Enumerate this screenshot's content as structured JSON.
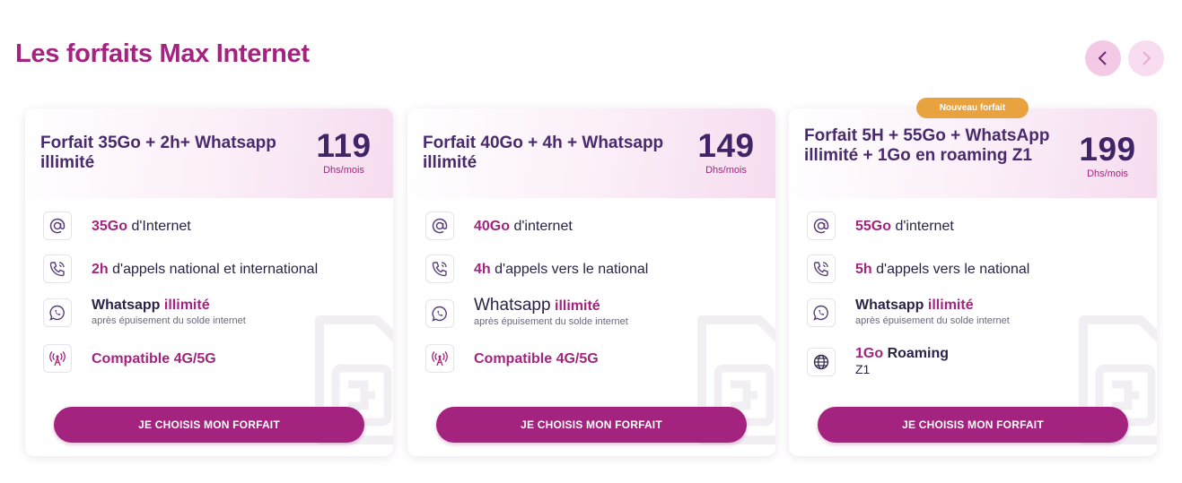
{
  "title": "Les forfaits Max Internet",
  "badge": "Nouveau forfait",
  "cards": [
    {
      "name": "Forfait 35Go + 2h+ Whatsapp illimité",
      "price": "119",
      "unit": "Dhs/mois",
      "f1_hl": "35Go",
      "f1_txt": "d'Internet",
      "f2_hl": "2h",
      "f2_txt": "d'appels national et international",
      "f3_txt": "Whatsapp",
      "f3_hl": "illimité",
      "f3_sub": "après épuisement du solde internet",
      "f4_hl": "Compatible 4G/5G",
      "cta": "JE CHOISIS MON FORFAIT"
    },
    {
      "name": "Forfait 40Go + 4h + Whatsapp illimité",
      "price": "149",
      "unit": "Dhs/mois",
      "f1_hl": "40Go",
      "f1_txt": "d'internet",
      "f2_hl": "4h",
      "f2_txt": "d'appels vers le national",
      "f3_txt": "Whatsapp",
      "f3_hl": "illimité",
      "f3_sub": "après épuisement du solde internet",
      "f4_hl": "Compatible 4G/5G",
      "cta": "JE CHOISIS MON FORFAIT"
    },
    {
      "name": "Forfait 5H + 55Go + WhatsApp illimité + 1Go en roaming Z1",
      "price": "199",
      "unit": "Dhs/mois",
      "f1_hl": "55Go",
      "f1_txt": "d'internet",
      "f2_hl": "5h",
      "f2_txt": "d'appels vers le national",
      "f3_txt": "Whatsapp",
      "f3_hl": "illimité",
      "f3_sub": "après épuisement du solde internet",
      "f4_hl": "1Go",
      "f4_txt": "Roaming",
      "f4_line2": "Z1",
      "cta": "JE CHOISIS MON FORFAIT"
    }
  ],
  "icons": {
    "at": "at-icon",
    "phone": "phone-icon",
    "whatsapp": "whatsapp-icon",
    "antenna": "antenna-icon",
    "globe": "globe-icon",
    "prev": "chevron-left-icon",
    "next": "chevron-right-icon",
    "sim": "sim-card-icon"
  },
  "colors": {
    "brand": "#a3237f",
    "dark": "#3f2466",
    "badge": "#e8a23e"
  }
}
